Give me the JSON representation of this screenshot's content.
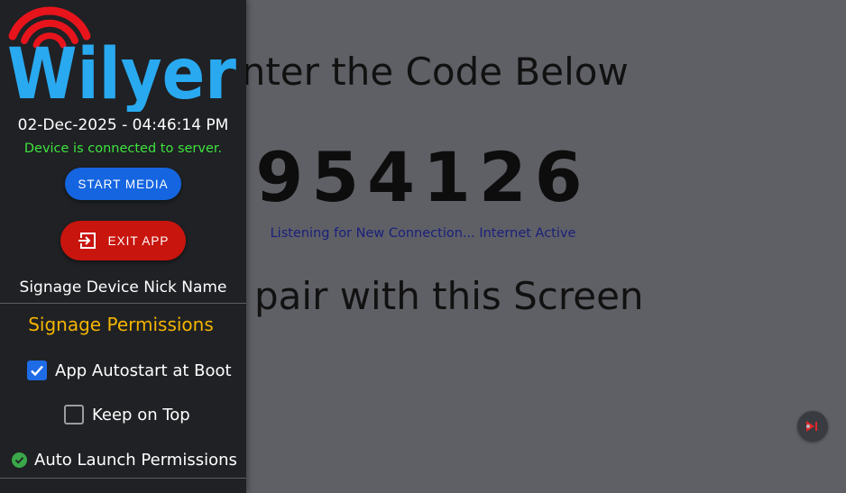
{
  "main": {
    "heading_top": "Enter the Code Below",
    "pair_code": "954126",
    "listen_status": "Listening for New Connection... Internet Active",
    "heading_bottom": "To pair with this Screen"
  },
  "drawer": {
    "logo_text": "Wilyer",
    "datetime": "02-Dec-2025 - 04:46:14 PM",
    "connection_status": "Device is connected to server.",
    "start_media_label": "START MEDIA",
    "exit_app_label": "EXIT APP",
    "nickname_label": "Signage Device Nick Name",
    "permissions_title": "Signage Permissions",
    "permissions": [
      {
        "label": "App Autostart at Boot",
        "checked": true
      },
      {
        "label": "Keep on Top",
        "checked": false
      },
      {
        "label": "Auto Launch Permissions",
        "granted": true
      }
    ]
  },
  "colors": {
    "accent_blue": "#1565e0",
    "danger_red": "#c8150e",
    "status_green": "#3ee33e",
    "permission_title": "#f4b400",
    "logo_blue": "#29a9f0",
    "logo_red": "#e8141c"
  },
  "icons": [
    "wifi-signal-icon",
    "exit-icon",
    "check-icon",
    "check-circle-icon",
    "cast-icon"
  ]
}
